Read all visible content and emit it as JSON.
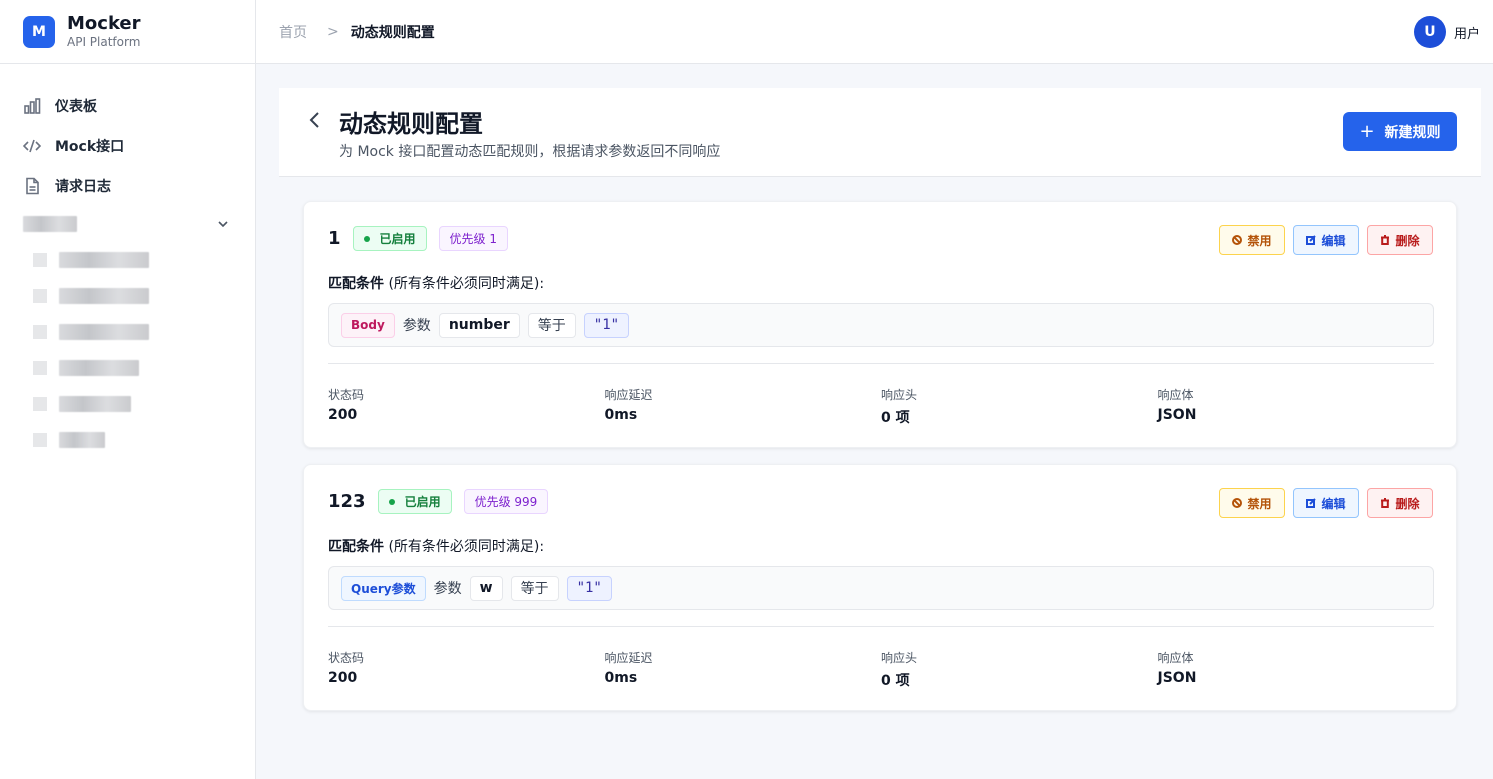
{
  "brand": {
    "logo_letter": "M",
    "name": "Mocker",
    "subtitle": "API Platform"
  },
  "sidebar": {
    "items": [
      {
        "label": "仪表板",
        "icon": "bar-chart-icon"
      },
      {
        "label": "Mock接口",
        "icon": "code-icon"
      },
      {
        "label": "请求日志",
        "icon": "document-icon"
      }
    ]
  },
  "breadcrumb": {
    "home": "首页",
    "separator": ">",
    "current": "动态规则配置"
  },
  "user": {
    "avatar_letter": "U",
    "name": "用户"
  },
  "page": {
    "title": "动态规则配置",
    "subtitle": "为 Mock 接口配置动态匹配规则，根据请求参数返回不同响应",
    "new_button": "新建规则"
  },
  "common": {
    "condition_label_bold": "匹配条件",
    "condition_label_rest": " (所有条件必须同时满足):",
    "param_label": "参数",
    "stat_labels": {
      "status": "状态码",
      "delay": "响应延迟",
      "headers": "响应头",
      "body": "响应体"
    },
    "actions": {
      "disable": "禁用",
      "edit": "编辑",
      "delete": "删除"
    }
  },
  "rules": [
    {
      "name": "1",
      "status": "已启用",
      "priority": "优先级 1",
      "condition": {
        "source": "Body",
        "key": "number",
        "operator": "等于",
        "value": "\"1\""
      },
      "stats": {
        "status": "200",
        "delay": "0ms",
        "headers": "0 项",
        "body": "JSON"
      }
    },
    {
      "name": "123",
      "status": "已启用",
      "priority": "优先级 999",
      "condition": {
        "source": "Query参数",
        "key": "w",
        "operator": "等于",
        "value": "\"1\""
      },
      "stats": {
        "status": "200",
        "delay": "0ms",
        "headers": "0 项",
        "body": "JSON"
      }
    }
  ],
  "colors": {
    "primary": "#2563eb",
    "success": "#16a34a",
    "priority": "#7e22ce",
    "warning": "#b45309",
    "danger": "#b91c1c"
  }
}
